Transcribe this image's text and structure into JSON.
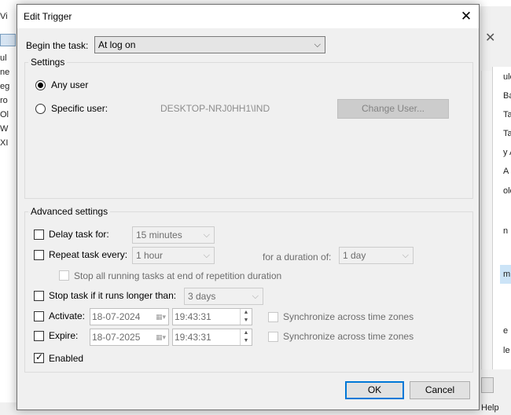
{
  "background": {
    "left_items": [
      "Vi",
      "ul",
      "ne",
      "eg",
      "ro",
      "Ol",
      "W",
      "XI"
    ],
    "right_items": [
      "ule",
      "Ba",
      "Ta",
      "Ta",
      "y A",
      "A",
      "olo",
      "n",
      "m",
      "e",
      "le"
    ],
    "help_label": "Help"
  },
  "dialog": {
    "title": "Edit Trigger",
    "begin_label": "Begin the task:",
    "begin_value": "At log on",
    "settings": {
      "title": "Settings",
      "any_user_label": "Any user",
      "specific_user_label": "Specific user:",
      "user_name": "DESKTOP-NRJ0HH1\\IND",
      "change_user_label": "Change User...",
      "selected": "any_user"
    },
    "advanced": {
      "title": "Advanced settings",
      "delay": {
        "label": "Delay task for:",
        "value": "15 minutes",
        "checked": false
      },
      "repeat": {
        "label": "Repeat task every:",
        "value": "1 hour",
        "checked": false,
        "duration_label": "for a duration of:",
        "duration_value": "1 day"
      },
      "stop_running": {
        "label": "Stop all running tasks at end of repetition duration",
        "checked": false
      },
      "stop_longer": {
        "label": "Stop task if it runs longer than:",
        "value": "3 days",
        "checked": false
      },
      "activate": {
        "label": "Activate:",
        "date": "18-07-2024",
        "time": "19:43:31",
        "checked": false
      },
      "expire": {
        "label": "Expire:",
        "date": "18-07-2025",
        "time": "19:43:31",
        "checked": false
      },
      "sync_label": "Synchronize across time zones",
      "enabled": {
        "label": "Enabled",
        "checked": true
      }
    },
    "ok_label": "OK",
    "cancel_label": "Cancel"
  },
  "colors": {
    "accent": "#0078d7",
    "disabled_text": "#6d6d6d"
  }
}
